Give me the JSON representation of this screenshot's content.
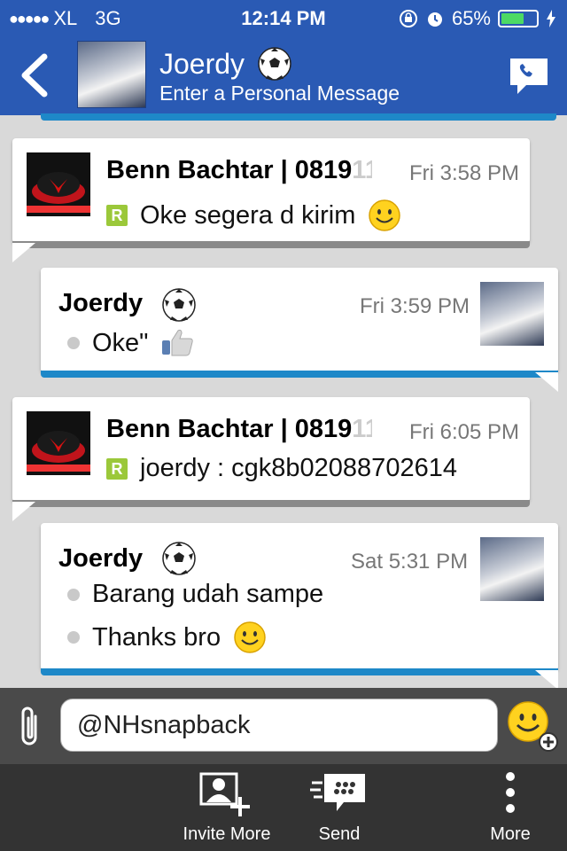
{
  "status_bar": {
    "carrier": "XL",
    "network": "3G",
    "time": "12:14 PM",
    "battery_percent": "65%",
    "battery_level": 0.65
  },
  "header": {
    "contact_name": "Joerdy",
    "personal_message": "Enter a Personal Message",
    "name_icon": "soccer-ball-icon"
  },
  "messages": [
    {
      "direction": "in",
      "sender": "Benn Bachtar | 0819",
      "sender_fade": "11",
      "time": "Fri 3:58 PM",
      "lines": [
        "Oke segera d kirim"
      ],
      "emoji": "smiley"
    },
    {
      "direction": "out",
      "sender": "Joerdy",
      "time": "Fri 3:59 PM",
      "lines": [
        "Oke\""
      ],
      "emoji": "thumbs-up"
    },
    {
      "direction": "in",
      "sender": "Benn Bachtar | 0819",
      "sender_fade": "11",
      "time": "Fri 6:05 PM",
      "lines": [
        "joerdy : cgk8b02088702614"
      ]
    },
    {
      "direction": "out",
      "sender": "Joerdy",
      "time": "Sat 5:31 PM",
      "lines": [
        "Barang udah sampe",
        "Thanks bro"
      ],
      "emoji": "smiley"
    }
  ],
  "composer": {
    "value": "@NHsnapback"
  },
  "toolbar": {
    "invite_label": "Invite More",
    "send_label": "Send",
    "more_label": "More"
  },
  "colors": {
    "header_blue": "#2a5ab4",
    "accent_blue": "#1e88c8",
    "badge_green": "#9bc83a"
  }
}
